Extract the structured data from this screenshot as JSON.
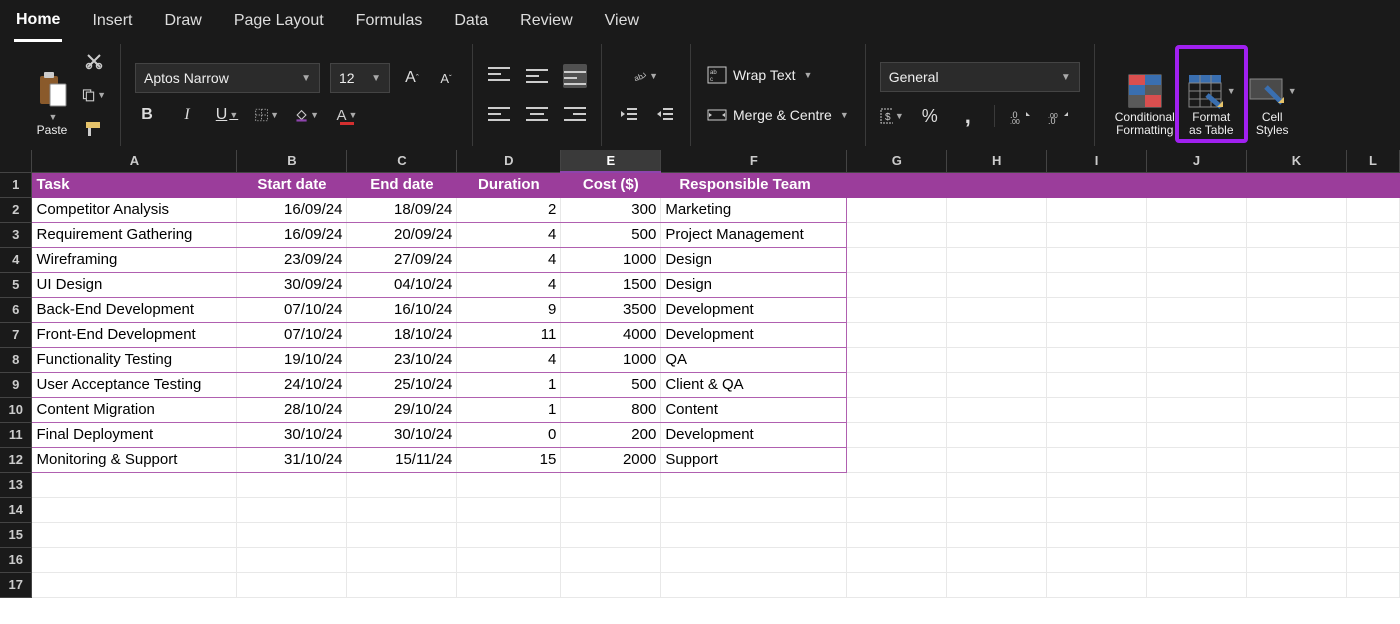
{
  "tabs": [
    "Home",
    "Insert",
    "Draw",
    "Page Layout",
    "Formulas",
    "Data",
    "Review",
    "View"
  ],
  "active_tab": 0,
  "ribbon": {
    "paste": "Paste",
    "font_name": "Aptos Narrow",
    "font_size": "12",
    "bold": "B",
    "italic": "I",
    "underline": "U",
    "wrap": "Wrap Text",
    "merge": "Merge & Centre",
    "number_format": "General",
    "cond_fmt": "Conditional\nFormatting",
    "fmt_table": "Format\nas Table",
    "cell_styles": "Cell\nStyles"
  },
  "columns": [
    "A",
    "B",
    "C",
    "D",
    "E",
    "F",
    "G",
    "H",
    "I",
    "J",
    "K",
    "L"
  ],
  "selected_col": "E",
  "visible_rows": 17,
  "table": {
    "headers": [
      "Task",
      "Start date",
      "End date",
      "Duration",
      "Cost ($)",
      "Responsible Team"
    ],
    "rows": [
      [
        "Competitor Analysis",
        "16/09/24",
        "18/09/24",
        "2",
        "300",
        "Marketing"
      ],
      [
        "Requirement Gathering",
        "16/09/24",
        "20/09/24",
        "4",
        "500",
        "Project Management"
      ],
      [
        "Wireframing",
        "23/09/24",
        "27/09/24",
        "4",
        "1000",
        "Design"
      ],
      [
        "UI Design",
        "30/09/24",
        "04/10/24",
        "4",
        "1500",
        "Design"
      ],
      [
        "Back-End Development",
        "07/10/24",
        "16/10/24",
        "9",
        "3500",
        "Development"
      ],
      [
        "Front-End Development",
        "07/10/24",
        "18/10/24",
        "11",
        "4000",
        "Development"
      ],
      [
        "Functionality Testing",
        "19/10/24",
        "23/10/24",
        "4",
        "1000",
        "QA"
      ],
      [
        "User Acceptance Testing",
        "24/10/24",
        "25/10/24",
        "1",
        "500",
        "Client & QA"
      ],
      [
        "Content Migration",
        "28/10/24",
        "29/10/24",
        "1",
        "800",
        "Content"
      ],
      [
        "Final Deployment",
        "30/10/24",
        "30/10/24",
        "0",
        "200",
        "Development"
      ],
      [
        "Monitoring & Support",
        "31/10/24",
        "15/11/24",
        "15",
        "2000",
        "Support"
      ]
    ]
  },
  "highlight": {
    "target": "fmt_table"
  }
}
